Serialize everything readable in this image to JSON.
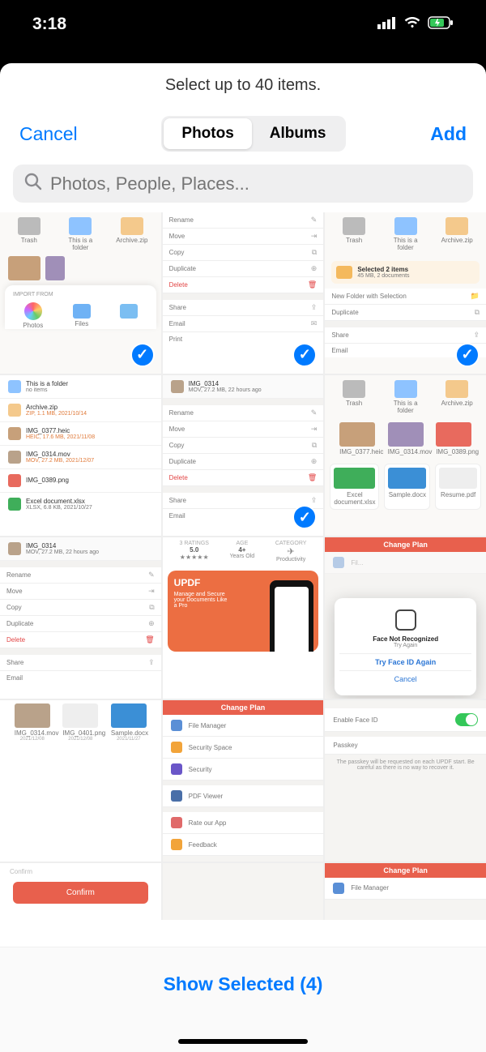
{
  "status": {
    "time": "3:18"
  },
  "sheet": {
    "title": "Select up to 40 items.",
    "cancel": "Cancel",
    "add": "Add",
    "tabs": {
      "photos": "Photos",
      "albums": "Albums"
    },
    "search_placeholder": "Photos, People, Places..."
  },
  "bottom": {
    "show_selected": "Show Selected (4)"
  },
  "mini_common": {
    "rename": "Rename",
    "move": "Move",
    "copy": "Copy",
    "duplicate": "Duplicate",
    "delete": "Delete",
    "share": "Share",
    "email": "Email",
    "print": "Print",
    "trash": "Trash",
    "folder_label": "This is a folder",
    "archive": "Archive.zip",
    "import_from": "IMPORT FROM",
    "photos": "Photos",
    "files": "Files",
    "new_folder_sel": "New Folder with Selection",
    "selected_two": "Selected 2 items",
    "selected_sub": "45 MB, 2 documents",
    "change_plan": "Change Plan",
    "file_manager": "File Manager",
    "security_space": "Security Space",
    "security": "Security",
    "pdf_viewer": "PDF Viewer",
    "rate_app": "Rate our App",
    "feedback": "Feedback",
    "enable_faceid": "Enable Face ID",
    "passkey": "Passkey",
    "passkey_note": "The passkey will be requested on each UPDF start. Be careful as there is no way to recover it.",
    "face_not_rec": "Face Not Recognized",
    "try_again": "Try Again",
    "try_faceid_again": "Try Face ID Again",
    "cancel": "Cancel",
    "confirm": "Confirm",
    "updf": "UPDF",
    "updf_tag": "Manage and Secure your Documents Like a Pro",
    "ratings": "3 RATINGS",
    "rating_val": "5.0",
    "age_hdr": "AGE",
    "age": "4+",
    "age_sub": "Years Old",
    "cat_hdr": "CATEGORY",
    "cat_sub": "Productivity"
  },
  "mini_files": {
    "f1": "This is a folder",
    "f1s": "no items",
    "f2": "Archive.zip",
    "f2s": "ZIP, 1.1 MB, 2021/10/14",
    "f3": "IMG_0377.heic",
    "f3s": "HEIC, 17.6 MB, 2021/11/08",
    "f4": "IMG_0314.mov",
    "f4s": "MOV, 27.2 MB, 2021/12/07",
    "f5": "IMG_0389.png",
    "f5s": "",
    "f6": "Excel document.xlsx",
    "f6s": "XLSX, 6.8 KB, 2021/10/27",
    "f7": "IMG_0314",
    "f7s": "MOV, 27.2 MB, 22 hours ago"
  },
  "mini_thumbs": {
    "a": "IMG_0377.heic",
    "b": "IMG_0314.mov",
    "c": "IMG_0389.png",
    "d": "Excel document.xlsx",
    "e": "Sample.docx",
    "f": "Resume.pdf",
    "g": "IMG_0314.mov",
    "h": "IMG_0401.png",
    "i": "Sample.docx",
    "date1": "2021/12/08",
    "date2": "2021/12/08",
    "date3": "2021/11/27"
  }
}
